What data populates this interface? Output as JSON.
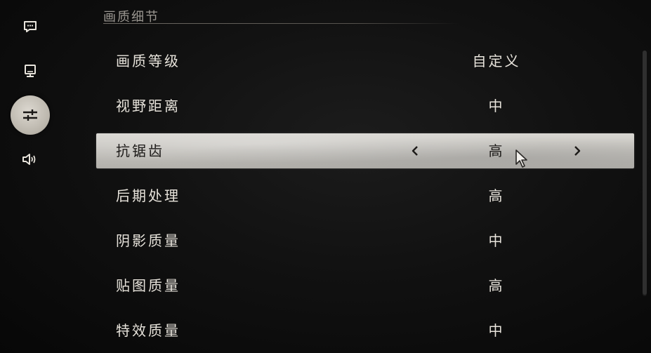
{
  "sidebar": {
    "items": [
      {
        "icon": "chat-bubble-icon",
        "active": false
      },
      {
        "icon": "monitor-display-icon",
        "active": false
      },
      {
        "icon": "sliders-icon",
        "active": true
      },
      {
        "icon": "speaker-sound-icon",
        "active": false
      }
    ]
  },
  "section": {
    "title": "画质细节"
  },
  "settings": [
    {
      "label": "画质等级",
      "value": "自定义"
    },
    {
      "label": "视野距离",
      "value": "中"
    },
    {
      "label": "抗锯齿",
      "value": "高"
    },
    {
      "label": "后期处理",
      "value": "高"
    },
    {
      "label": "阴影质量",
      "value": "中"
    },
    {
      "label": "贴图质量",
      "value": "高"
    },
    {
      "label": "特效质量",
      "value": "中"
    }
  ],
  "selected_index": 2,
  "colors": {
    "background": "#0b0b0b",
    "text": "#e8e4dc",
    "selected_text": "#1d1b19",
    "section_title": "#9b9791",
    "selected_row": "#c4c2bd"
  }
}
